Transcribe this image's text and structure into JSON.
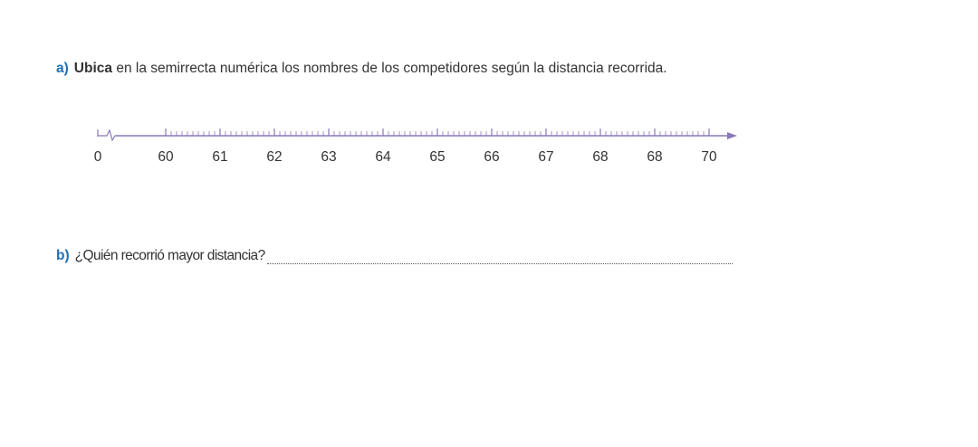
{
  "question_a": {
    "label": "a)",
    "bold_word": "Ubica",
    "text": " en la semirrecta numérica los nombres de los competidores según la distancia recorrida."
  },
  "number_line": {
    "origin_label": "0",
    "tick_labels": [
      "60",
      "61",
      "62",
      "63",
      "64",
      "65",
      "66",
      "67",
      "68",
      "68",
      "70"
    ],
    "minor_divisions_per_unit": 10,
    "color": "#8a78b8"
  },
  "question_b": {
    "label": "b)",
    "text": "¿Quién recorrió mayor distancia?"
  }
}
